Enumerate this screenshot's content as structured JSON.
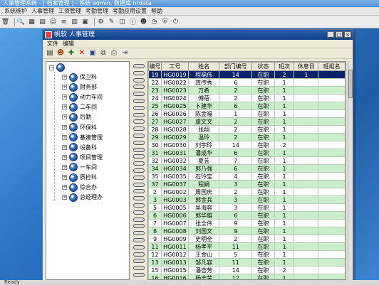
{
  "window": {
    "title": "人事管理系统 - [ 档案管理 ] - 系统 admin, 数据库 hrdata"
  },
  "main_menu": [
    "系统维护",
    "人事管理",
    "工资管理",
    "考勤管理",
    "考勤应用设置",
    "帮助"
  ],
  "child": {
    "title": "帆软 人事管理",
    "menu": [
      "文件",
      "编辑"
    ],
    "controls": {
      "minimize": "_",
      "maximize": "□",
      "close": "×"
    }
  },
  "tree": {
    "items": [
      {
        "label": "保卫科"
      },
      {
        "label": "财务部"
      },
      {
        "label": "动力车间"
      },
      {
        "label": "二车间"
      },
      {
        "label": "后勤"
      },
      {
        "label": "环保科"
      },
      {
        "label": "基建管理"
      },
      {
        "label": "设备科"
      },
      {
        "label": "项目管理"
      },
      {
        "label": "一车间"
      },
      {
        "label": "质检科"
      },
      {
        "label": "综合办"
      },
      {
        "label": "总经理办"
      }
    ]
  },
  "table": {
    "headers": [
      "编号",
      "工号",
      "姓名",
      "部门编号",
      "状态",
      "班次",
      "休息日",
      "班组名"
    ],
    "rows": [
      [
        "19",
        "HG0019",
        "程福伟",
        "14",
        "在职",
        "2",
        "1",
        ""
      ],
      [
        "22",
        "HG0022",
        "龚传秀",
        "6",
        "在职",
        "1",
        "",
        ""
      ],
      [
        "23",
        "HG0023",
        "万希",
        "2",
        "在职",
        "1",
        "",
        ""
      ],
      [
        "24",
        "HG0024",
        "傅蓓",
        "2",
        "在职",
        "1",
        "",
        ""
      ],
      [
        "25",
        "HG0025",
        "卜建华",
        "6",
        "在职",
        "1",
        "",
        ""
      ],
      [
        "26",
        "HG0026",
        "陈金福",
        "1",
        "在职",
        "1",
        "",
        ""
      ],
      [
        "27",
        "HG0027",
        "虞文文",
        "2",
        "在职",
        "1",
        "",
        ""
      ],
      [
        "28",
        "HG0028",
        "张翔",
        "2",
        "在职",
        "1",
        "",
        ""
      ],
      [
        "29",
        "HG0029",
        "温玲",
        "2",
        "在职",
        "1",
        "",
        ""
      ],
      [
        "30",
        "HG0030",
        "刘宇玲",
        "14",
        "在职",
        "2",
        "",
        ""
      ],
      [
        "31",
        "HG0031",
        "潘成华",
        "6",
        "在职",
        "1",
        "",
        ""
      ],
      [
        "32",
        "HG0032",
        "夏芸",
        "7",
        "在职",
        "1",
        "",
        ""
      ],
      [
        "34",
        "HG0034",
        "郭乃强",
        "6",
        "在职",
        "1",
        "",
        ""
      ],
      [
        "35",
        "HG0035",
        "石玲宝",
        "4",
        "在职",
        "1",
        "",
        ""
      ],
      [
        "37",
        "HG0037",
        "程娟",
        "3",
        "在职",
        "1",
        "",
        ""
      ],
      [
        "2",
        "HG0002",
        "周国庆",
        "2",
        "在职",
        "1",
        "",
        ""
      ],
      [
        "3",
        "HG0003",
        "郭金兵",
        "3",
        "在职",
        "1",
        "",
        ""
      ],
      [
        "5",
        "HG0005",
        "吴海容",
        "3",
        "在职",
        "1",
        "",
        ""
      ],
      [
        "6",
        "HG0006",
        "郭华雄",
        "6",
        "在职",
        "1",
        "",
        ""
      ],
      [
        "7",
        "HG0007",
        "张全伟",
        "9",
        "在职",
        "1",
        "",
        ""
      ],
      [
        "8",
        "HG0008",
        "刘国文",
        "9",
        "在职",
        "1",
        "",
        ""
      ],
      [
        "9",
        "HG0009",
        "史明全",
        "2",
        "在职",
        "1",
        "",
        ""
      ],
      [
        "11",
        "HG0011",
        "杨孝平",
        "11",
        "在职",
        "1",
        "",
        ""
      ],
      [
        "12",
        "HG0012",
        "王金山",
        "5",
        "在职",
        "1",
        "",
        ""
      ],
      [
        "13",
        "HG0013",
        "邹凡容",
        "11",
        "在职",
        "1",
        "",
        ""
      ],
      [
        "15",
        "HG0015",
        "潘杏芳",
        "14",
        "在职",
        "2",
        "",
        ""
      ],
      [
        "16",
        "HG0016",
        "杨志荣",
        "12",
        "在职",
        "1",
        "",
        ""
      ],
      [
        "17",
        "HG0017",
        "卞月福",
        "6",
        "在职",
        "1",
        "",
        ""
      ]
    ]
  },
  "status": {
    "text": "Ready"
  }
}
